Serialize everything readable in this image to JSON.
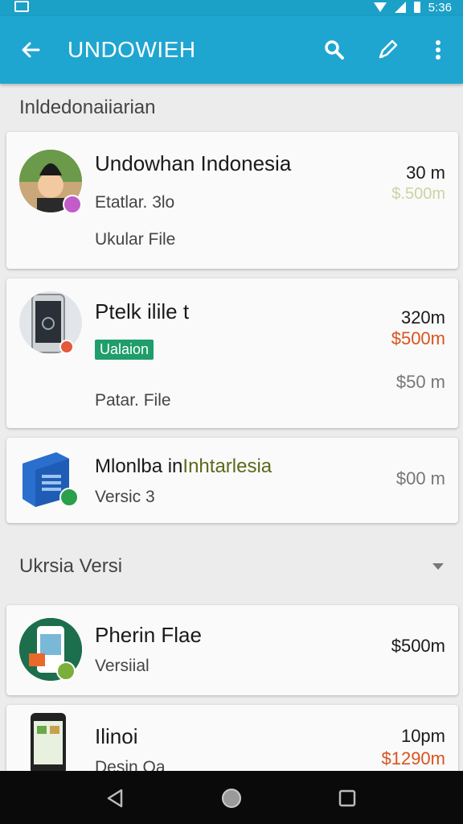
{
  "status_bar": {
    "time": "5:36"
  },
  "app_bar": {
    "title": "UNDOWIEH"
  },
  "sections": [
    {
      "title": "Inldedonaiiarian"
    },
    {
      "title": "Ukrsia  Versi"
    }
  ],
  "items": [
    {
      "name": "Undowhan Indonesia",
      "subtitle": "Etatlar. 3lo",
      "detail": "Ukular File",
      "time": "30 m",
      "price": "$.500m"
    },
    {
      "name": "Ptelk ilile t",
      "tag": "Ualaion",
      "detail": "Patar. File",
      "time": "320m",
      "price": "$500m",
      "price2": "$50 m"
    },
    {
      "name": "Mlonlba in",
      "name_highlight": "Inhtarlesia",
      "subtitle": "Versic 3",
      "price": "$00 m"
    },
    {
      "name": "Pherin Flae",
      "subtitle": "Versiial",
      "price": "$500m"
    },
    {
      "name": "Ilinoi",
      "subtitle": "Desin Oa",
      "time": "10pm",
      "price": "$1290m"
    }
  ],
  "colors": {
    "app_bar": "#1fa6d0",
    "accent_red": "#d9531e",
    "tag_green": "#1f9d6a"
  }
}
